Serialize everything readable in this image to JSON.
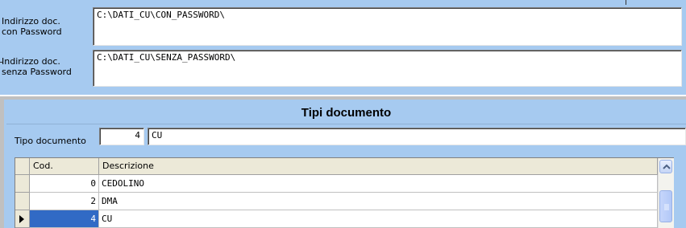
{
  "paths": {
    "with_password_label": "Indirizzo doc.\ncon Password",
    "with_password_value": "C:\\DATI_CU\\CON_PASSWORD\\",
    "without_password_label": "Indirizzo doc.\nsenza Password",
    "without_password_value": "C:\\DATI_CU\\SENZA_PASSWORD\\"
  },
  "doc_types": {
    "title": "Tipi documento",
    "type_label": "Tipo documento",
    "type_code": "4",
    "type_description": "CU"
  },
  "grid": {
    "columns": [
      "Cod.",
      "Descrizione"
    ],
    "rows": [
      {
        "code": "0",
        "description": "CEDOLINO"
      },
      {
        "code": "2",
        "description": "DMA"
      },
      {
        "code": "4",
        "description": "CU"
      }
    ],
    "selected_row": 2
  },
  "icons": {
    "current_row": "triangle-right-icon",
    "scroll_up": "chevron-up-icon",
    "scroll_thumb": "grip-icon"
  }
}
